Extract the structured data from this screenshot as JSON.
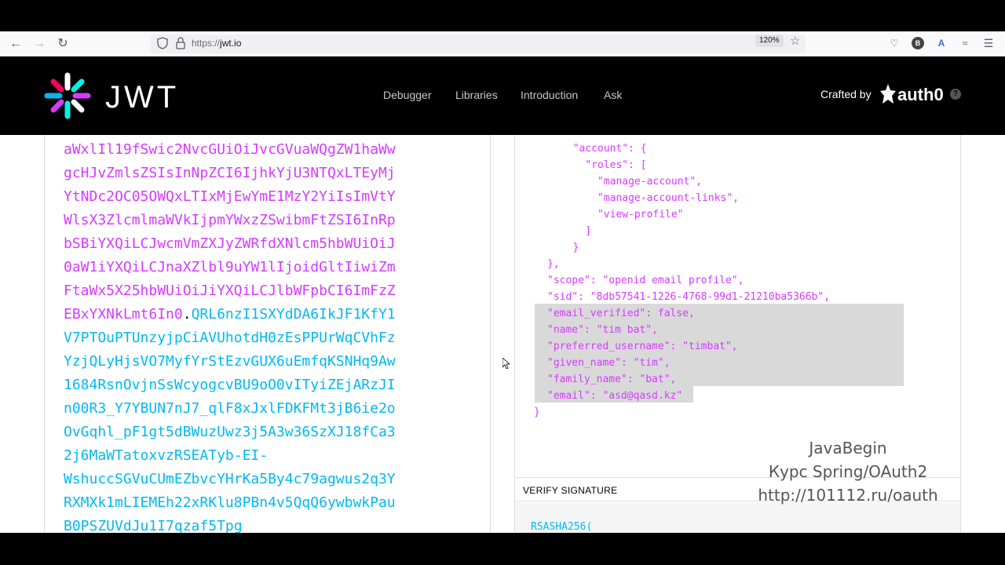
{
  "browser": {
    "url_protocol": "https://",
    "url_host": "jwt.io",
    "zoom": "120%"
  },
  "header": {
    "logo_text": "JWT",
    "nav": [
      "Debugger",
      "Libraries",
      "Introduction",
      "Ask"
    ],
    "crafted_by": "Crafted by",
    "auth0": "auth0",
    "help": "?"
  },
  "encoded_token": {
    "payload_lines": [
      "aWxlIl19fSwic2NvcGUiOiJvcGVuaWQgZW1haWw",
      "gcHJvZmlsZSIsInNpZCI6IjhkYjU3NTQxLTEyMj",
      "YtNDc2OC05OWQxLTIxMjEwYmE1MzY2YiIsImVtY",
      "WlsX3ZlcmlmaWVkIjpmYWxzZSwibmFtZSI6InRp",
      "bSBiYXQiLCJwcmVmZXJyZWRfdXNlcm5hbWUiOiJ",
      "0aW1iYXQiLCJnaXZlbl9uYW1lIjoidGltIiwiZm",
      "FtaWx5X25hbWUiOiJiYXQiLCJlbWFpbCI6ImFzZ"
    ],
    "mixed_line_payload": "EBxYXNkLmt6In0",
    "mixed_line_dot": ".",
    "mixed_line_signature": "QRL6nzI1SXYdDA6IkJF1KfY1",
    "signature_lines": [
      "V7PTOuPTUnzyjpCiAVUhotdH0zEsPPUrWqCVhFz",
      "YzjQLyHjsVO7MyfYrStEzvGUX6uEmfqKSNHq9Aw",
      "1684RsnOvjnSsWcyogcvBU9oO0vITyiZEjARzJI",
      "n00R3_Y7YBUN7nJ7_qlF8xJxlFDKFMt3jB6ie2o",
      "OvGqhl_pF1gt5dBWuzUwz3j5A3w36SzXJ18fCa3",
      "2j6MaWTatoxvzRSEATyb-EI-",
      "WshuccSGVuCUmEZbvcYHrKa5By4c79agwus2q3Y",
      "RXMXk1mLIEMEh22xRKlu8PBn4v5QqQ6ywbwkPau",
      "B0PSZUVdJu1I7qzaf5Tpg"
    ]
  },
  "decoded_payload": {
    "lines": [
      "  \"account\": {",
      "    \"roles\": [",
      "      \"manage-account\",",
      "      \"manage-account-links\",",
      "      \"view-profile\"",
      "    ]",
      "  }",
      "},",
      "\"scope\": \"openid email profile\",",
      "\"sid\": \"8db57541-1226-4768-99d1-21210ba5366b\",",
      "\"email_verified\": false,",
      "\"name\": \"tim bat\",",
      "\"preferred_username\": \"timbat\",",
      "\"given_name\": \"tim\",",
      "\"family_name\": \"bat\",",
      "\"email\": \"asd@qasd.kz\""
    ],
    "closing": "}"
  },
  "verify": {
    "label": "VERIFY SIGNATURE",
    "algorithm": "RSASHA256("
  },
  "watermark": {
    "line1": "JavaBegin",
    "line2": "Курс Spring/OAuth2",
    "line3": "http://101112.ru/oauth"
  }
}
